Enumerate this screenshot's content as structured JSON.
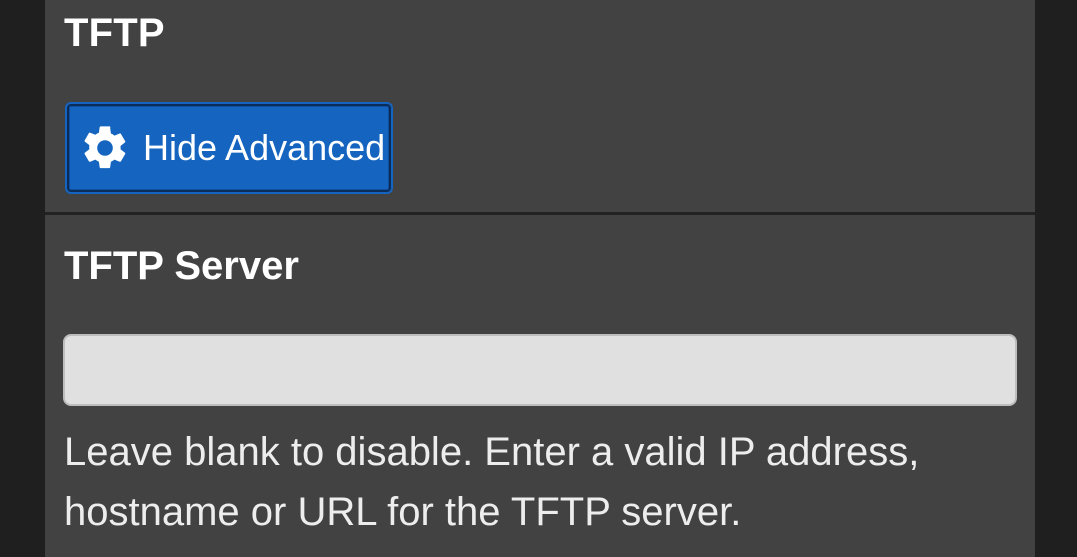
{
  "section": {
    "title": "TFTP",
    "advanced_button_label": "Hide Advanced",
    "advanced_button_icon": "gear-icon"
  },
  "tftp_server": {
    "label": "TFTP Server",
    "value": "",
    "placeholder": "",
    "help": "Leave blank to disable. Enter a valid IP address, hostname or URL for the TFTP server."
  },
  "colors": {
    "page_background": "#1f1f1f",
    "panel_background": "#424242",
    "button_primary": "#1565c0",
    "input_background": "#e0e0e0",
    "text": "#ffffff"
  }
}
